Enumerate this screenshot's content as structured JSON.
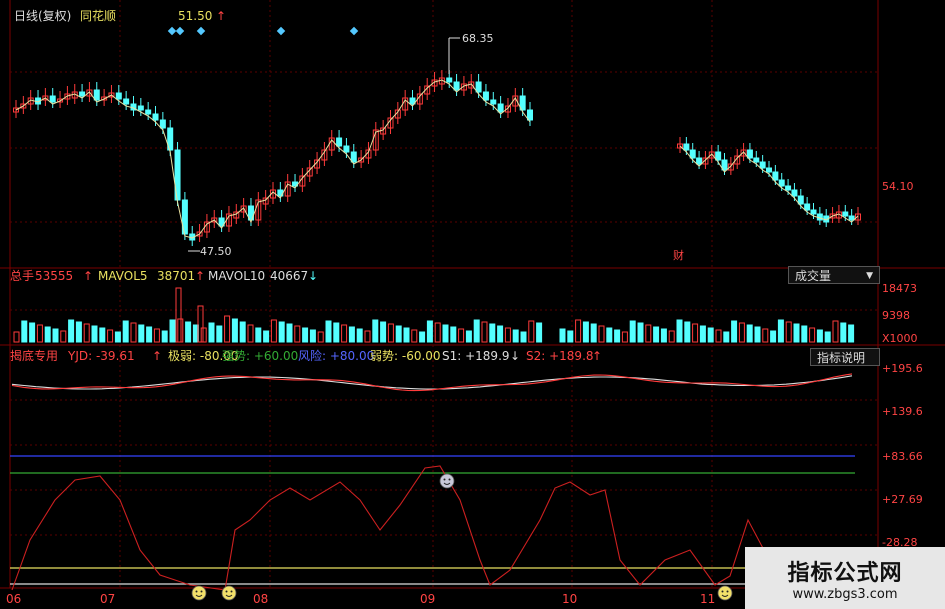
{
  "header": {
    "title": "日线(复权)",
    "app": "同花顺",
    "price_marker": "51.50",
    "up_arrow": "↑"
  },
  "price_annotations": {
    "high": "68.35",
    "low": "47.50"
  },
  "price_axis": {
    "label_1": "54.10"
  },
  "event_marker": "财",
  "volume": {
    "label_total": "总手",
    "total_val": "53555",
    "ma5_label": "MAVOL5",
    "ma5_val": "38701",
    "ma10_label": "MAVOL10",
    "ma10_val": "40667",
    "dropdown": "成交量",
    "axis": [
      "18473",
      "9398",
      "X1000"
    ]
  },
  "indicator": {
    "name": "揭底专用",
    "yjd": "YJD: -39.61",
    "jiruo": "极弱: -80.00",
    "qiangshi": "强势: +60.00",
    "fengxian": "风险: +80.00",
    "ruoshi": "弱势: -60.00",
    "s1": "S1: +189.9",
    "s2": "S2: +189.8",
    "help_button": "指标说明",
    "axis": [
      "+195.6",
      "+139.6",
      "+83.66",
      "+27.69",
      "-28.28"
    ]
  },
  "time_axis": [
    "06",
    "07",
    "08",
    "09",
    "10",
    "11"
  ],
  "watermark": {
    "title": "指标公式网",
    "url": "www.zbgs3.com"
  },
  "colors": {
    "up": "#ff3b3b",
    "down": "#54ffff",
    "grid": "#5a0000",
    "text_red": "#ff4444",
    "text_yellow": "#e8e060",
    "text_white": "#dddddd",
    "blue_line": "#3344ff",
    "green_line": "#33aa33",
    "white_line": "#dddddd"
  },
  "chart_data": [
    {
      "type": "candlestick",
      "title": "日线(复权)",
      "y_labels": [
        "68.35",
        "54.10",
        "47.50"
      ],
      "x_labels": [
        "06",
        "07",
        "08",
        "09",
        "10",
        "11"
      ]
    },
    {
      "type": "bar",
      "title": "成交量",
      "y_labels": [
        "18473",
        "9398",
        "X1000"
      ]
    },
    {
      "type": "line",
      "title": "揭底专用",
      "y_labels": [
        "+195.6",
        "+139.6",
        "+83.66",
        "+27.69",
        "-28.28"
      ]
    }
  ]
}
